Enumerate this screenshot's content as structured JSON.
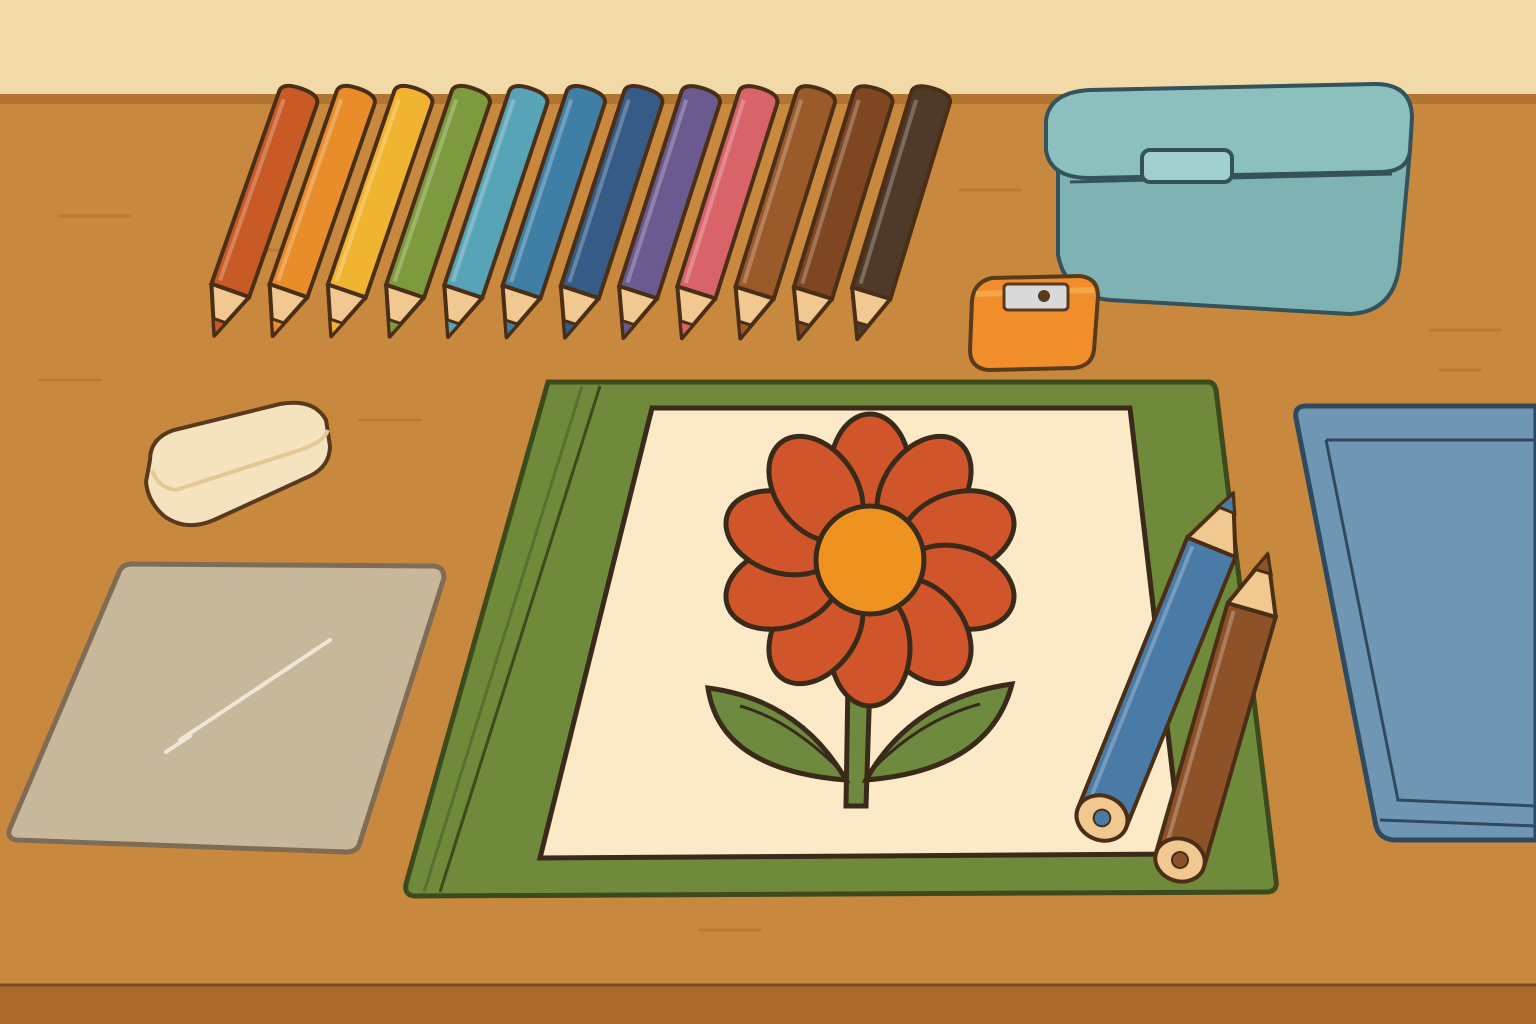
{
  "scene": {
    "colors": {
      "wall": "#f2d9a8",
      "desk": "#c8893e",
      "desk_edge": "#b27431",
      "outline": "#5a3a1c",
      "wood_tip": "#f0c890",
      "mat": "#6f8a3b",
      "paper": "#fbe9c8",
      "petal": "#d0552a",
      "flower_center": "#ee9320",
      "leaf": "#6d8a3e",
      "pencil_box": "#7fb3b3",
      "sharpener": "#ef8e2a",
      "eraser": "#f5e3c0",
      "sheet": "#c9bca3",
      "book": "#6f97b3"
    },
    "pencils": [
      {
        "name": "red-orange",
        "color": "#c85a26"
      },
      {
        "name": "orange",
        "color": "#e88d2a"
      },
      {
        "name": "yellow",
        "color": "#f0b431"
      },
      {
        "name": "olive-green",
        "color": "#7e9a3e"
      },
      {
        "name": "light-blue",
        "color": "#57a4b8"
      },
      {
        "name": "blue",
        "color": "#3f7fa6"
      },
      {
        "name": "dark-blue",
        "color": "#355b86"
      },
      {
        "name": "purple",
        "color": "#6a5a8f"
      },
      {
        "name": "pink",
        "color": "#d8646a"
      },
      {
        "name": "brown",
        "color": "#9a5a2a"
      },
      {
        "name": "dark-brown",
        "color": "#7e4722"
      },
      {
        "name": "black-brown",
        "color": "#4f3a2a"
      }
    ],
    "loose_pencils": [
      {
        "name": "blue",
        "color": "#4a7aa6"
      },
      {
        "name": "brown",
        "color": "#8e5228"
      }
    ]
  }
}
